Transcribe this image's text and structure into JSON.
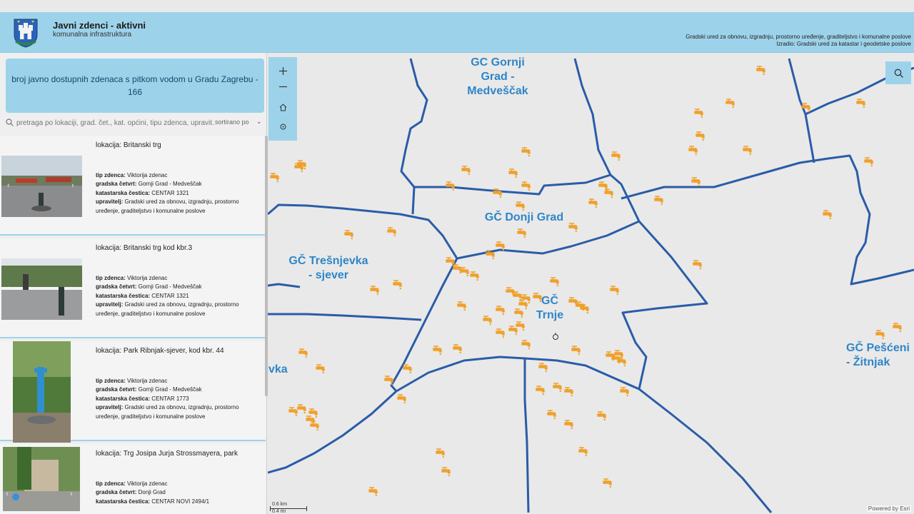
{
  "header": {
    "title": "Javni zdenci - aktivni",
    "subtitle": "komunalna infrastruktura",
    "credit_line1": "Gradski ured za obnovu, izgradnju, prostorno uređenje, graditeljstvo i komunalne poslove",
    "credit_line2": "Izradio: Gradski ured za katastar i geodetske poslove"
  },
  "sidebar": {
    "info": "broj javno dostupnih zdenaca s pitkom vodom u Gradu Zagrebu - 166",
    "search_placeholder": "pretraga po lokaciji, grad. čet., kat. općini, tipu zdenca, upravit...",
    "sort_label": "sortirano po",
    "labels": {
      "lokacija": "lokacija:",
      "tip": "tip zdenca:",
      "cetvrt": "gradska četvrt:",
      "katastar": "katastarska čestica:",
      "upravitelj": "upravitelj:"
    },
    "cards": [
      {
        "lokacija": "Britanski trg",
        "tip": "Viktorija zdenac",
        "cetvrt": "Gornji Grad - Medveščak",
        "katastar": "CENTAR 1321",
        "upravitelj": "Gradski ured za obnovu, izgradnju, prostorno uređenje, graditeljstvo i komunalne poslove"
      },
      {
        "lokacija": "Britanski trg kod kbr.3",
        "tip": "Viktorija zdenac",
        "cetvrt": "Gornji Grad - Medveščak",
        "katastar": "CENTAR 1321",
        "upravitelj": "Gradski ured za obnovu, izgradnju, prostorno uređenje, graditeljstvo i komunalne poslove"
      },
      {
        "lokacija": "Park Ribnjak-sjever, kod kbr. 44",
        "tip": "Viktorija zdenac",
        "cetvrt": "Gornji Grad - Medveščak",
        "katastar": "CENTAR 1773",
        "upravitelj": "Gradski ured za obnovu, izgradnju, prostorno uređenje, graditeljstvo i komunalne poslove"
      },
      {
        "lokacija": "Trg Josipa Jurja Strossmayera, park",
        "tip": "Viktorija zdenac",
        "cetvrt": "Donji Grad",
        "katastar": "CENTAR NOVI 2494/1",
        "upravitelj": ""
      }
    ]
  },
  "map": {
    "districts": [
      "GČ Gornji Grad - Medveščak",
      "GČ Donji Grad",
      "GČ Trešnjevka - sjever",
      "GČ Trnje",
      "GČ Pešćenica - Žitnjak",
      "vka"
    ],
    "district_lines": {
      "gornji": [
        "GČ Gornji",
        "Grad -",
        "Medveščak"
      ],
      "donji": [
        "GČ Donji Grad"
      ],
      "tresnjevka": [
        "GČ Trešnjevka",
        "- sjever"
      ],
      "trnje": [
        "GČ",
        "Trnje"
      ],
      "pescenica": [
        "GČ Pešćeni",
        "- Žitnjak"
      ],
      "vka": [
        "vka"
      ]
    },
    "scale_km": "0.6 km",
    "scale_mi": "0.4 mi",
    "attribution": "Powered by Esri",
    "icons": {
      "zoom_in": "plus-icon",
      "zoom_out": "minus-icon",
      "home": "home-icon",
      "locate": "locate-icon",
      "search": "search-icon",
      "fountain": "water-tap-icon"
    },
    "colors": {
      "boundary": "#2a5ca8",
      "fountain": "#f0a02a",
      "label": "#2e86c8",
      "header": "#9dd3ea"
    }
  }
}
